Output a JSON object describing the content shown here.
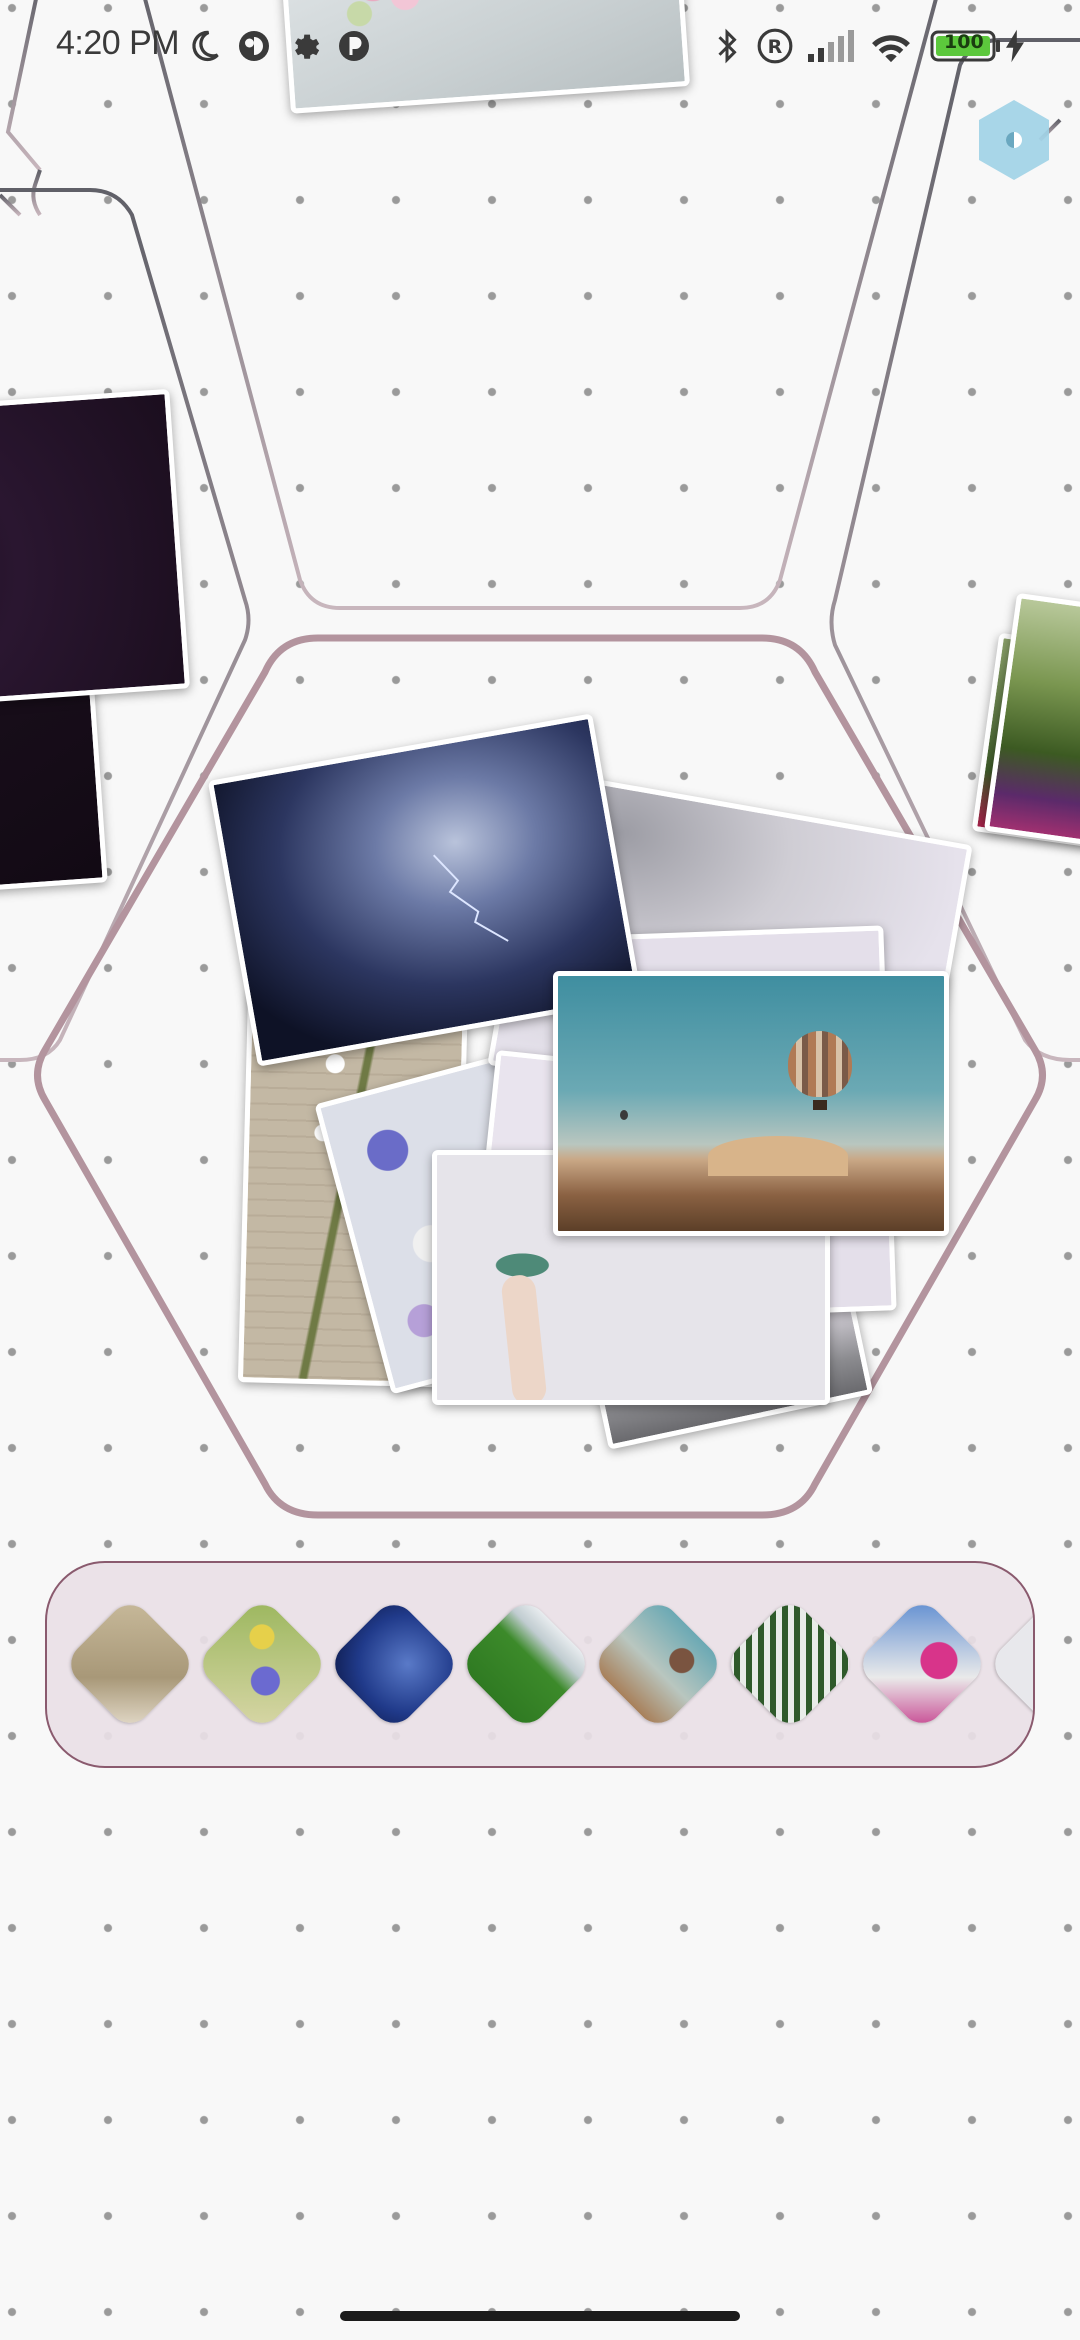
{
  "status_bar": {
    "time": "4:20 PM",
    "battery": "100",
    "icons": [
      "moon-icon",
      "app-notification-icon",
      "settings-gear-icon",
      "app-notification-icon",
      "bluetooth-icon",
      "registered-icon",
      "signal-icon",
      "wifi-icon",
      "battery-icon",
      "charging-bolt-icon"
    ]
  },
  "colors": {
    "background": "#f8f8f8",
    "hex_outline_active": "#b3949e",
    "hex_outline": "#6e6e74",
    "strip_background": "#e9e0e6",
    "strip_border": "#8a5a6e",
    "fab": "#9ed2e6"
  },
  "album_hexes": [
    "album-top",
    "album-left",
    "album-center",
    "album-right"
  ],
  "center_album_photos": [
    "storm-clouds",
    "lily-of-the-valley",
    "pressed-flowers",
    "hand-holding-leaf",
    "landscape-pale",
    "misty-sky",
    "lavender-card",
    "hot-air-balloon"
  ],
  "thumbnail_strip": {
    "thumbnails": [
      "lily-of-the-valley",
      "wildflowers",
      "night-sky",
      "green-meadow",
      "hot-air-balloon",
      "fern-leaf",
      "bougainvillea",
      "partial"
    ]
  },
  "fab_icon": "half-circle-theme-icon"
}
